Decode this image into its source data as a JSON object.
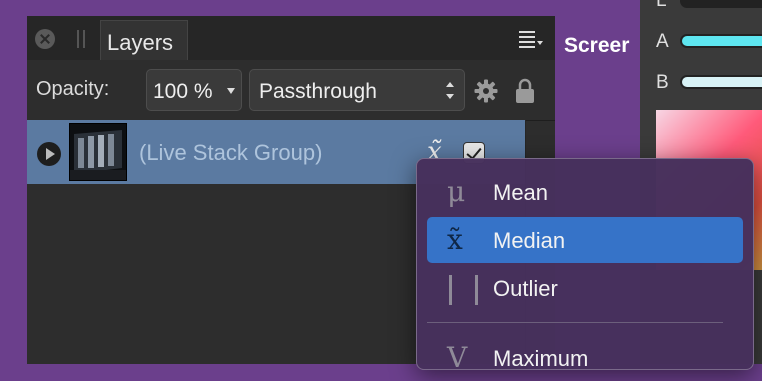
{
  "layers_panel": {
    "tab_label": "Layers",
    "opacity_label": "Opacity:",
    "opacity_value": "100 %",
    "blend_mode": "Passthrough",
    "layer": {
      "name": "(Live Stack Group)",
      "visible_checked": true
    }
  },
  "overflow_text": "Screer",
  "right_panel": {
    "labels": [
      "L",
      "A",
      "B"
    ],
    "colors": {
      "a_slider": "#5ee6f0",
      "b_slider": "#d8f2f6"
    }
  },
  "stack_menu": {
    "items": [
      {
        "label": "Mean",
        "icon": "mu-icon",
        "glyph": "μ",
        "selected": false
      },
      {
        "label": "Median",
        "icon": "x-tilde-icon",
        "glyph": "x̃",
        "selected": true
      },
      {
        "label": "Outlier",
        "icon": "outlier-bars-icon",
        "glyph": "",
        "selected": false
      },
      {
        "label": "Maximum",
        "icon": "v-icon",
        "glyph": "V",
        "selected": false
      }
    ]
  },
  "colors": {
    "background": "#6b3f8c",
    "selection": "#3673c8",
    "layer_highlight": "#5b7aa1"
  }
}
